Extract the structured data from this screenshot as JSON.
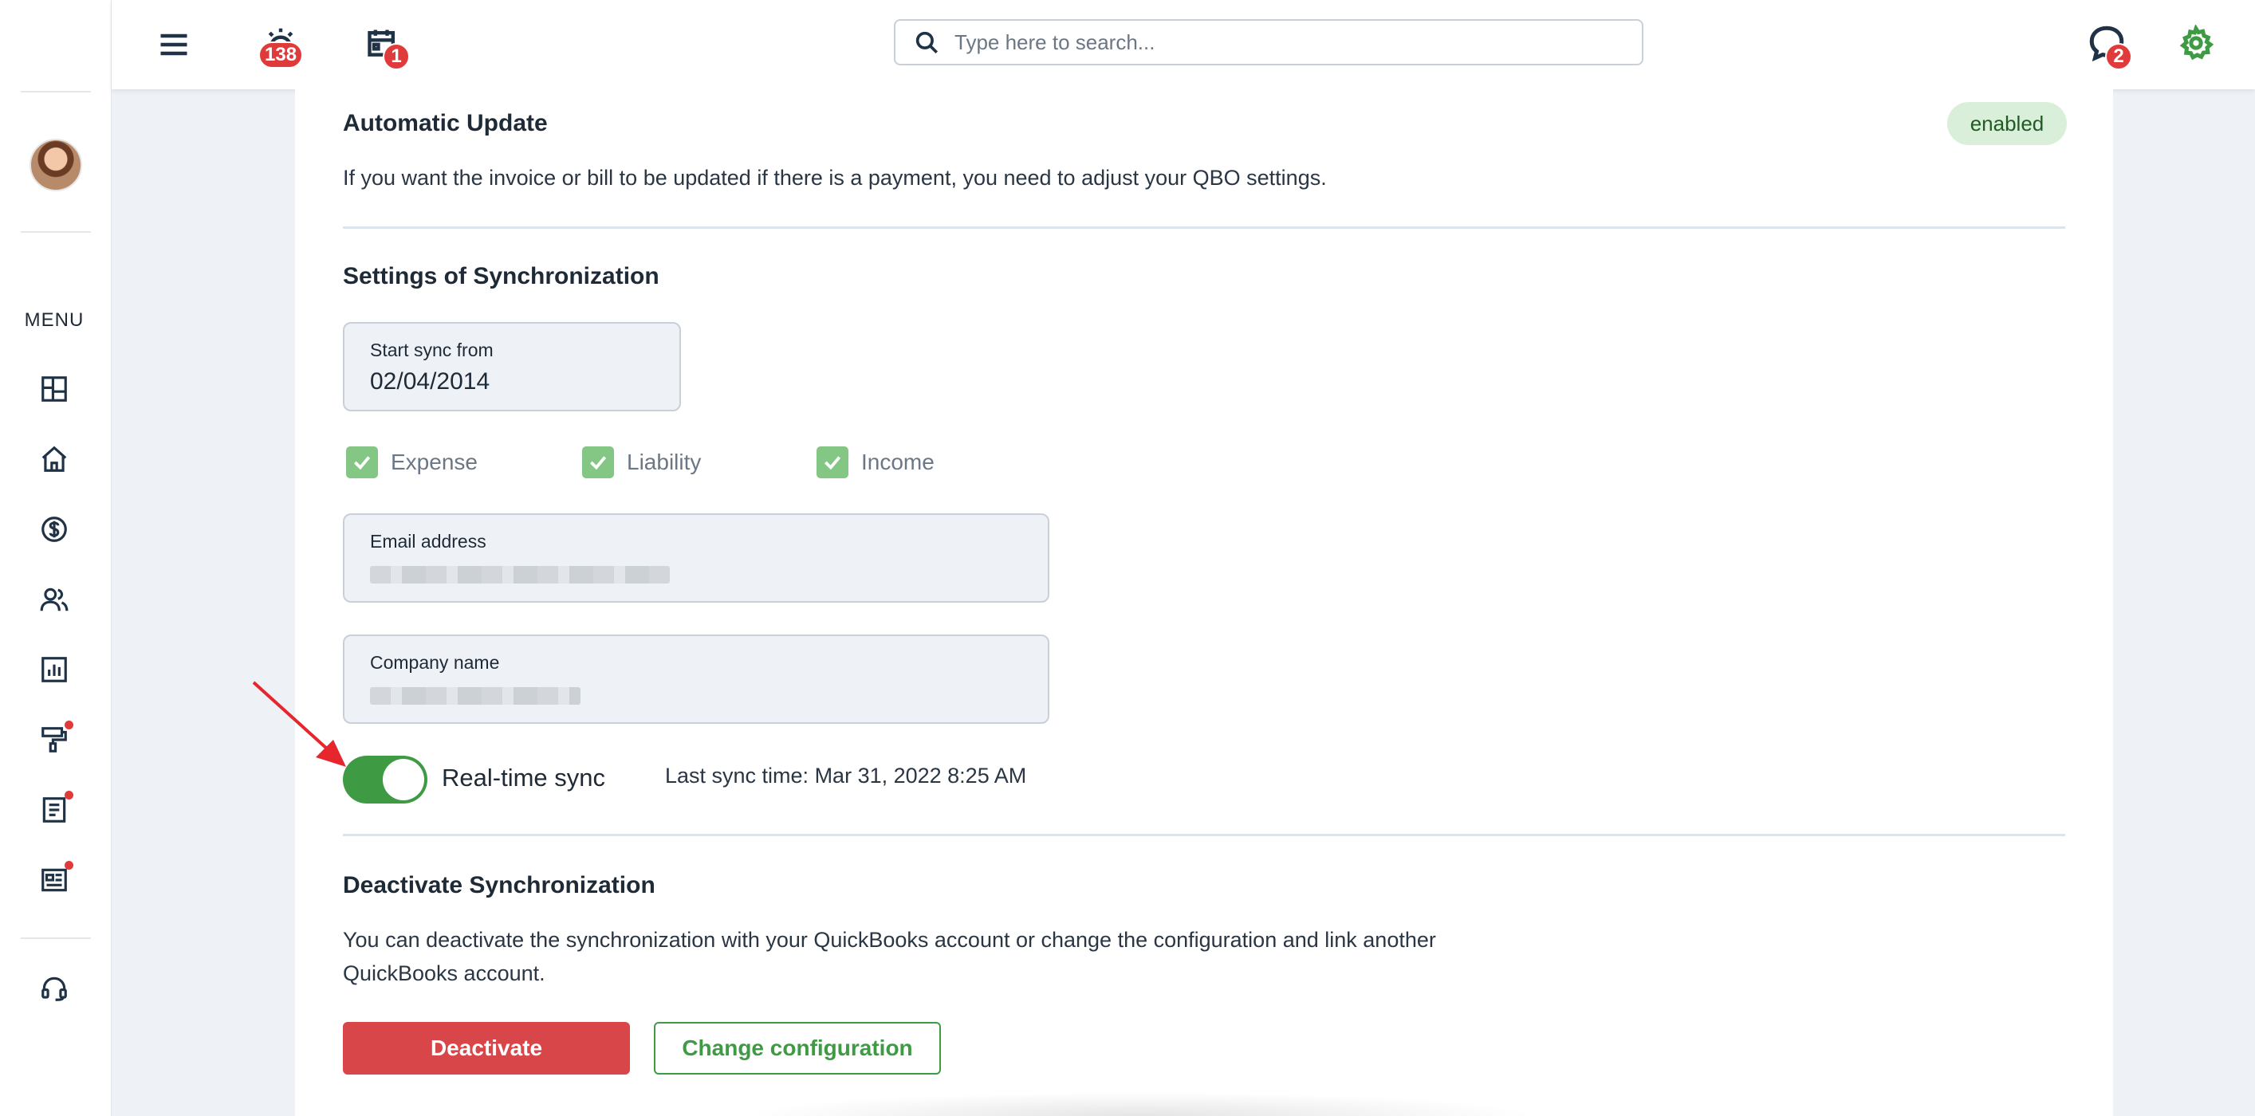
{
  "topbar": {
    "alarm_count": "138",
    "calendar_count": "1",
    "chat_count": "2",
    "search_placeholder": "Type here to search..."
  },
  "sidebar": {
    "menu_label": "MENU",
    "items": [
      {
        "icon": "dashboard-icon"
      },
      {
        "icon": "home-icon"
      },
      {
        "icon": "dollar-icon"
      },
      {
        "icon": "users-icon"
      },
      {
        "icon": "report-chart-icon"
      },
      {
        "icon": "paint-roller-icon",
        "has_dot": true
      },
      {
        "icon": "document-icon",
        "has_dot": true
      },
      {
        "icon": "news-icon",
        "has_dot": true
      }
    ],
    "support_icon": "headset-icon"
  },
  "automatic_update": {
    "title": "Automatic Update",
    "status": "enabled",
    "description": "If you want the invoice or bill to be updated if there is a payment, you need to adjust your QBO settings."
  },
  "sync_settings": {
    "title": "Settings of Synchronization",
    "start_sync_label": "Start sync from",
    "start_sync_value": "02/04/2014",
    "checkboxes": [
      {
        "label": "Expense",
        "checked": true
      },
      {
        "label": "Liability",
        "checked": true
      },
      {
        "label": "Income",
        "checked": true
      }
    ],
    "email_label": "Email address",
    "company_label": "Company name",
    "realtime_label": "Real-time sync",
    "realtime_on": true,
    "last_sync": "Last sync time: Mar 31, 2022 8:25 AM"
  },
  "deactivate": {
    "title": "Deactivate Synchronization",
    "description_line1": "You can deactivate the synchronization with your QuickBooks account or change the configuration and link another",
    "description_line2": "QuickBooks account.",
    "deactivate_label": "Deactivate",
    "change_label": "Change configuration"
  },
  "colors": {
    "accent_green": "#3f9b43",
    "danger_red": "#d9464a",
    "badge_red": "#e03b3b"
  }
}
